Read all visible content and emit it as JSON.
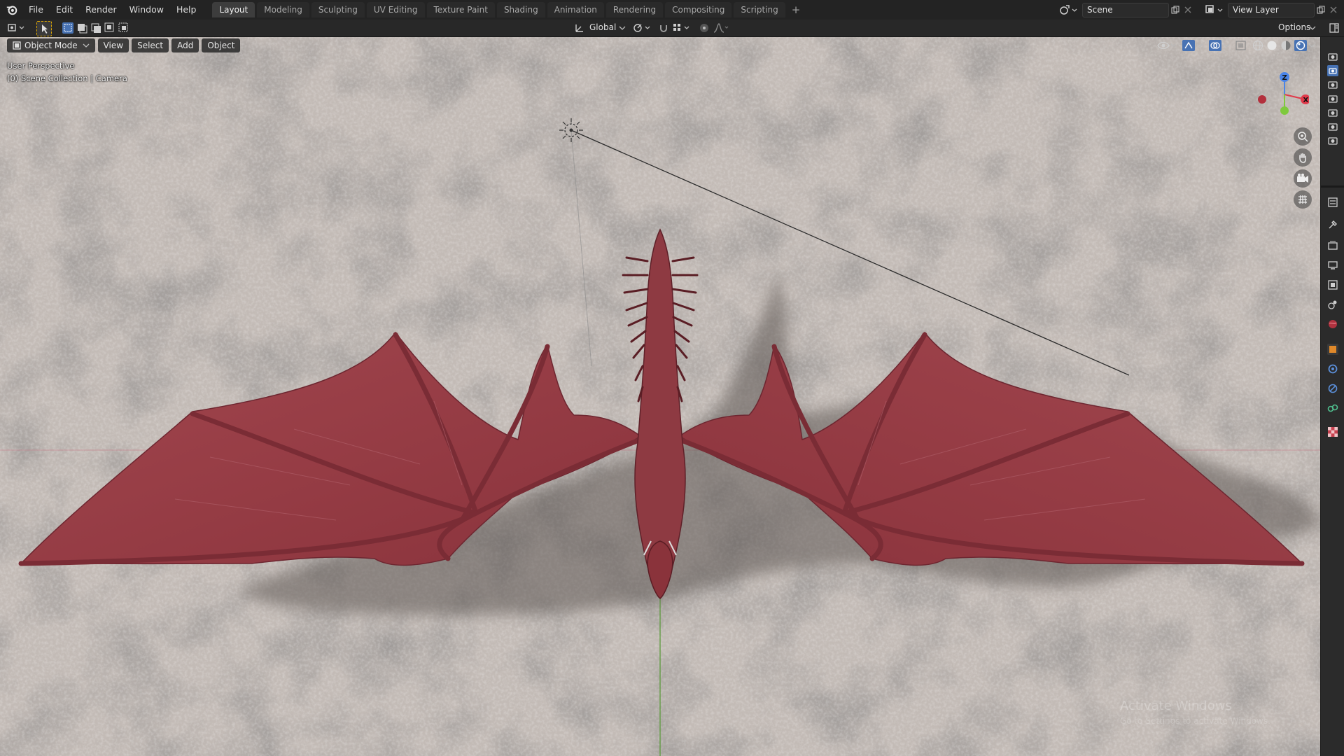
{
  "menu": [
    "File",
    "Edit",
    "Render",
    "Window",
    "Help"
  ],
  "workspaces": [
    {
      "label": "Layout",
      "active": true
    },
    {
      "label": "Modeling"
    },
    {
      "label": "Sculpting"
    },
    {
      "label": "UV Editing"
    },
    {
      "label": "Texture Paint"
    },
    {
      "label": "Shading"
    },
    {
      "label": "Animation"
    },
    {
      "label": "Rendering"
    },
    {
      "label": "Compositing"
    },
    {
      "label": "Scripting"
    }
  ],
  "add_workspace_label": "+",
  "scene": {
    "name": "Scene"
  },
  "view_layer": {
    "name": "View Layer"
  },
  "header2": {
    "transform_orientation": "Global",
    "options_label": "Options"
  },
  "viewport_header": {
    "mode": "Object Mode",
    "view": "View",
    "select": "Select",
    "add": "Add",
    "object": "Object"
  },
  "viewport": {
    "perspective_label": "User Perspective",
    "collection_label": "(0) Scene Collection | Camera"
  },
  "gizmo": {
    "x": "X",
    "y": "Y",
    "z": "Z"
  },
  "watermark": {
    "line1": "Activate Windows",
    "line2": "Go to Settings to activate Windows."
  },
  "colors": {
    "accent": "#4772b3",
    "floor": "#bdb5b0",
    "dragon": "#9a3b43",
    "x_axis": "#e03a4a",
    "y_axis": "#7fc93c",
    "z_axis": "#4a84e8"
  }
}
